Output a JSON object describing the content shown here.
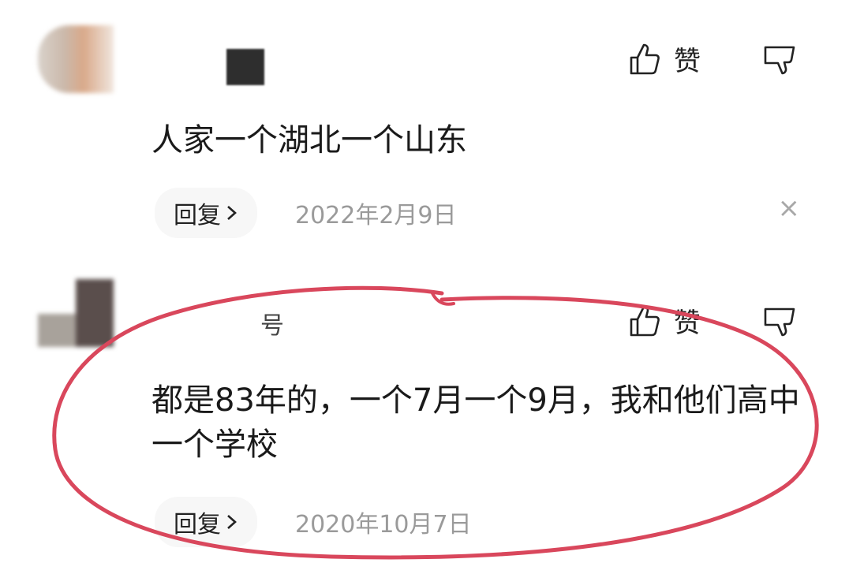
{
  "comments": [
    {
      "name": "",
      "like_label": "赞",
      "text": "人家一个湖北一个山东",
      "reply_label": "回复",
      "date": "2022年2月9日",
      "close_symbol": "×"
    },
    {
      "name": "号",
      "like_label": "赞",
      "text": "都是83年的，一个7月一个9月，我和他们高中一个学校",
      "reply_label": "回复",
      "date": "2020年10月7日"
    }
  ],
  "icons": {
    "like": "thumbs-up-icon",
    "dislike": "thumbs-down-icon",
    "chevron": "chevron-right-icon",
    "close": "close-icon"
  },
  "colors": {
    "annotation_circle": "#d9475c",
    "date_text": "#9a9a9a"
  }
}
